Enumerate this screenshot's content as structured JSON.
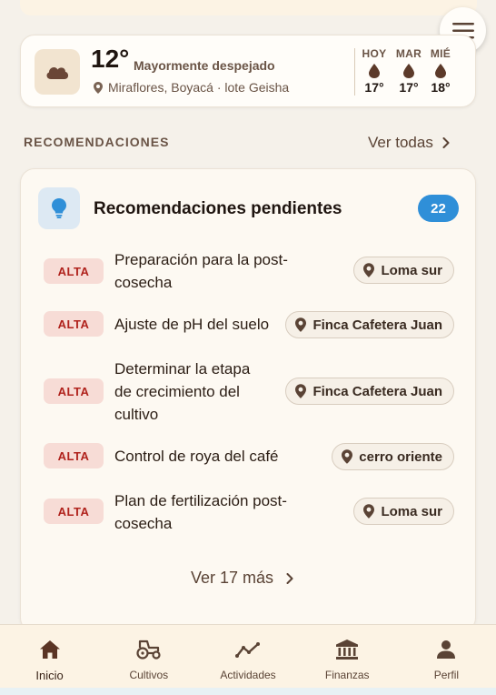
{
  "weather": {
    "temperature": "12°",
    "condition": "Mayormente despejado",
    "location": "Miraflores, Boyacá · lote Geisha",
    "icon": "cloud-icon",
    "forecast": [
      {
        "day": "HOY",
        "temp": "17°",
        "icon": "raindrop-icon"
      },
      {
        "day": "MAR",
        "temp": "17°",
        "icon": "raindrop-icon"
      },
      {
        "day": "MIÉ",
        "temp": "18°",
        "icon": "raindrop-icon"
      }
    ]
  },
  "recommendations": {
    "section_title": "RECOMENDACIONES",
    "see_all": "Ver todas",
    "card_title": "Recomendaciones pendientes",
    "count": "22",
    "items": [
      {
        "priority": "ALTA",
        "title": "Preparación para la post-cosecha",
        "location": "Loma sur"
      },
      {
        "priority": "ALTA",
        "title": "Ajuste de pH del suelo",
        "location": "Finca Cafetera Juan"
      },
      {
        "priority": "ALTA",
        "title": "Determinar la etapa de crecimiento del cultivo",
        "location": "Finca Cafetera Juan"
      },
      {
        "priority": "ALTA",
        "title": "Control de roya del café",
        "location": "cerro oriente"
      },
      {
        "priority": "ALTA",
        "title": "Plan de fertilización post-cosecha",
        "location": "Loma sur"
      }
    ],
    "more": "Ver 17 más"
  },
  "nav": [
    {
      "label": "Inicio",
      "icon": "home-icon",
      "active": true
    },
    {
      "label": "Cultivos",
      "icon": "tractor-icon"
    },
    {
      "label": "Actividades",
      "icon": "activity-icon"
    },
    {
      "label": "Finanzas",
      "icon": "bank-icon"
    },
    {
      "label": "Perfil",
      "icon": "user-icon"
    }
  ],
  "colors": {
    "background": "#f5f1ea",
    "accent_blue": "#2f8fd8",
    "priority_high_bg": "#f7dcd6",
    "priority_high_text": "#b0221c",
    "brown": "#5a4335"
  }
}
